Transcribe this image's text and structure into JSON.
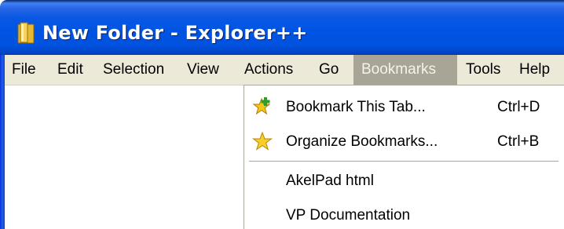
{
  "window": {
    "title": "New Folder - Explorer++",
    "icon": "folder-icon"
  },
  "menubar": {
    "items": [
      {
        "label": "File"
      },
      {
        "label": "Edit"
      },
      {
        "label": "Selection"
      },
      {
        "label": "View"
      },
      {
        "label": "Actions"
      },
      {
        "label": "Go"
      },
      {
        "label": "Bookmarks",
        "active": true
      },
      {
        "label": "Tools"
      },
      {
        "label": "Help"
      }
    ]
  },
  "bookmarks_menu": {
    "items": [
      {
        "label": "Bookmark This Tab...",
        "shortcut": "Ctrl+D",
        "icon": "bookmark-add-star-icon"
      },
      {
        "label": "Organize Bookmarks...",
        "shortcut": "Ctrl+B",
        "icon": "star-icon"
      },
      {
        "label": "AkelPad html"
      },
      {
        "label": "VP Documentation"
      }
    ]
  },
  "colors": {
    "titlebar": "#0054e3",
    "menubar": "#ece9d8",
    "active_menu": "#a8a597"
  }
}
